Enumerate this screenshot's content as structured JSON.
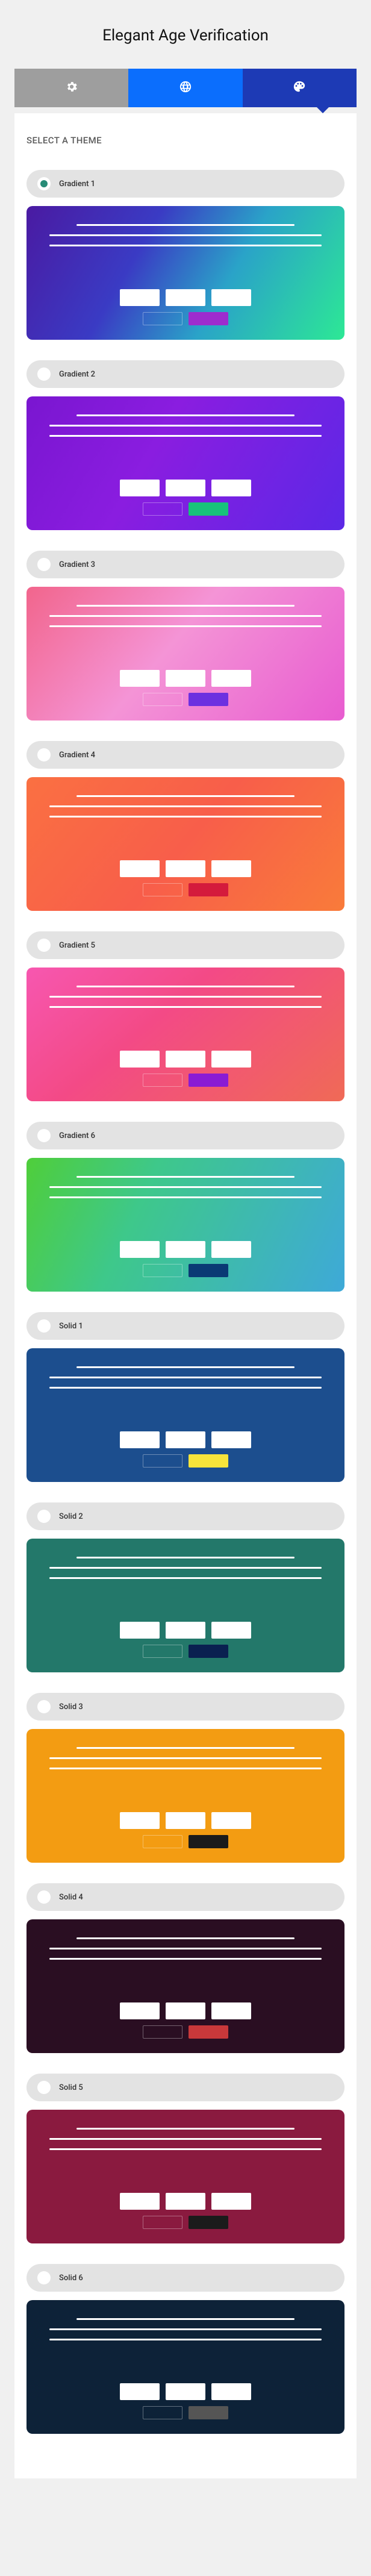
{
  "title": "Elegant Age Verification",
  "section_label": "SELECT A THEME",
  "tabs": [
    {
      "icon": "gear-icon"
    },
    {
      "icon": "globe-icon"
    },
    {
      "icon": "palette-icon"
    }
  ],
  "themes": [
    {
      "id": "gradient-1",
      "label": "Gradient 1",
      "class": "g1",
      "selected": true
    },
    {
      "id": "gradient-2",
      "label": "Gradient 2",
      "class": "g2",
      "selected": false
    },
    {
      "id": "gradient-3",
      "label": "Gradient 3",
      "class": "g3",
      "selected": false
    },
    {
      "id": "gradient-4",
      "label": "Gradient 4",
      "class": "g4",
      "selected": false
    },
    {
      "id": "gradient-5",
      "label": "Gradient 5",
      "class": "g5",
      "selected": false
    },
    {
      "id": "gradient-6",
      "label": "Gradient 6",
      "class": "g6",
      "selected": false
    },
    {
      "id": "solid-1",
      "label": "Solid 1",
      "class": "s1",
      "selected": false
    },
    {
      "id": "solid-2",
      "label": "Solid 2",
      "class": "s2",
      "selected": false
    },
    {
      "id": "solid-3",
      "label": "Solid 3",
      "class": "s3",
      "selected": false
    },
    {
      "id": "solid-4",
      "label": "Solid 4",
      "class": "s4",
      "selected": false
    },
    {
      "id": "solid-5",
      "label": "Solid 5",
      "class": "s5",
      "selected": false
    },
    {
      "id": "solid-6",
      "label": "Solid 6",
      "class": "s6",
      "selected": false
    }
  ]
}
